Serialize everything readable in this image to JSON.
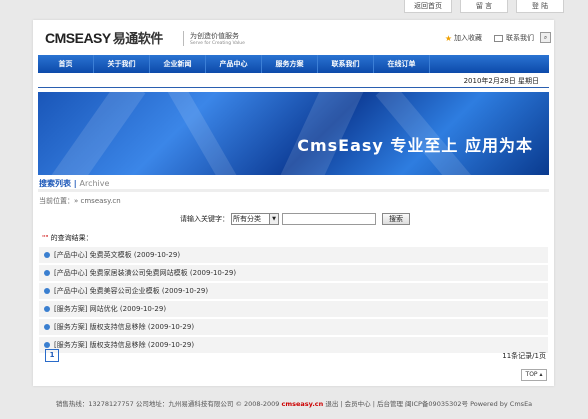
{
  "topnav": [
    "返回首页",
    "留 言",
    "登 陆"
  ],
  "header": {
    "logo_main": "CMSEASY",
    "logo_cn": "易通软件",
    "slogan1": "为创造价值服务",
    "slogan2": "Serve for Creating Value",
    "fav_label": "加入收藏",
    "contact_label": "联系我们"
  },
  "nav": [
    "首页",
    "关于我们",
    "企业新闻",
    "产品中心",
    "服务方案",
    "联系我们",
    "在线订单"
  ],
  "date_text": "2010年2月28日 星期日",
  "banner_text": "CmsEasy  专业至上  应用为本",
  "page_title": {
    "main": "搜索列表",
    "sep": " | ",
    "sub": " Archive"
  },
  "breadcrumb": "当前位置：» cmseasy.cn",
  "search": {
    "label": "请输入关键字：",
    "category": "所有分类",
    "button": "搜索"
  },
  "results_title_quote": "\"\"",
  "results_title": " 的查询结果：",
  "results": [
    "[产品中心] 免费英文模板 (2009-10-29)",
    "[产品中心] 免费家居装潢公司免费网站模板 (2009-10-29)",
    "[产品中心] 免费美容公司企业模板 (2009-10-29)",
    "[服务方案] 网站优化 (2009-10-29)",
    "[服务方案] 版权支持信息移除 (2009-10-29)",
    "[服务方案] 版权支持信息移除 (2009-10-29)"
  ],
  "pager_current": "1",
  "pager_count": "11条记录/1页",
  "top_button": "TOP",
  "footer": {
    "left": "销售热线：13278127757  公司地址：九州易通科技有限公司 © 2008-2009 ",
    "brand": "cmseasy.cn",
    "right": " 退出 | 会员中心 | 后台管理  闽ICP备09035302号 Powered by CmsEa"
  }
}
